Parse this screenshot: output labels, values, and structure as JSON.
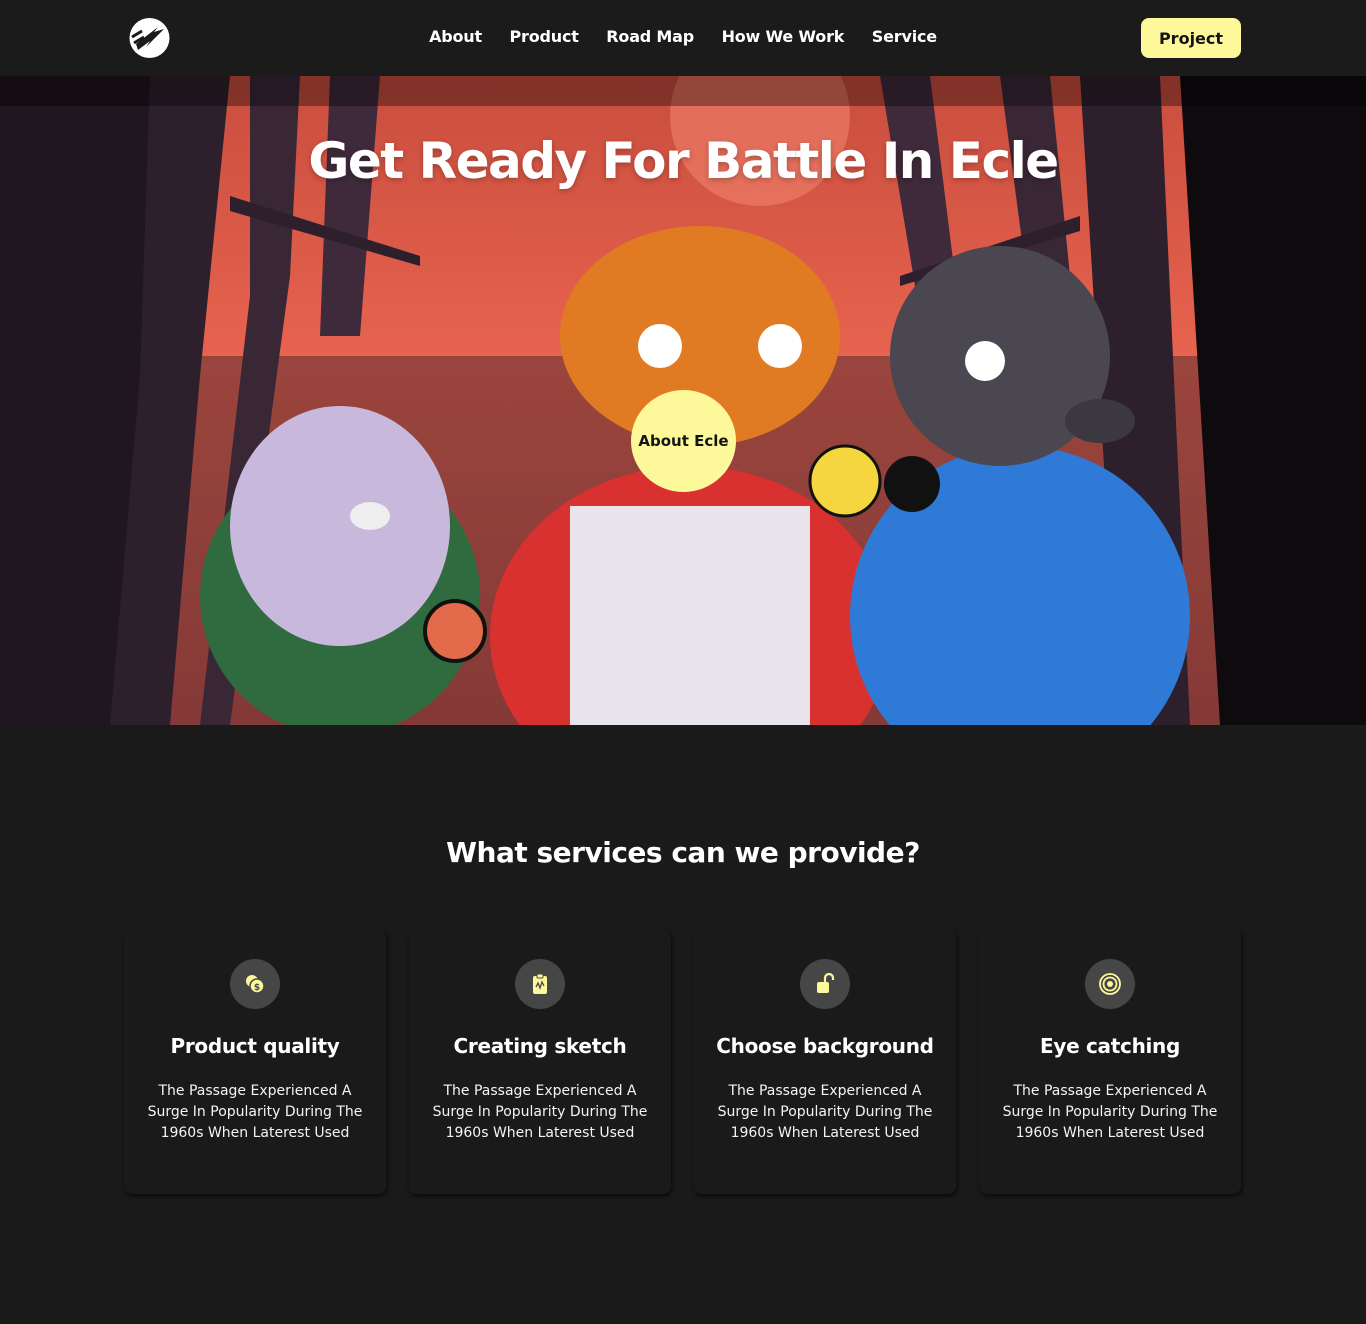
{
  "header": {
    "logo": "arrow-logo-icon",
    "nav": [
      "About",
      "Product",
      "Road Map",
      "How We Work",
      "Service"
    ],
    "cta_label": "Project"
  },
  "hero": {
    "title": "Get Ready For Battle In Ecle",
    "about_button": "About Ecle",
    "colors": {
      "sky": "#e8634d",
      "trees": "#2d1f2c",
      "accent": "#fdf99b"
    }
  },
  "services": {
    "heading": "What services can we provide?",
    "cards": [
      {
        "icon": "coins-icon",
        "title": "Product quality",
        "desc": "The Passage Experienced A Surge In Popularity During The 1960s When Laterest Used"
      },
      {
        "icon": "clipboard-icon",
        "title": "Creating sketch",
        "desc": "The Passage Experienced A Surge In Popularity During The 1960s When Laterest Used"
      },
      {
        "icon": "unlock-icon",
        "title": "Choose background",
        "desc": "The Passage Experienced A Surge In Popularity During The 1960s When Laterest Used"
      },
      {
        "icon": "target-icon",
        "title": "Eye catching",
        "desc": "The Passage Experienced A Surge In Popularity During The 1960s When Laterest Used"
      }
    ]
  }
}
